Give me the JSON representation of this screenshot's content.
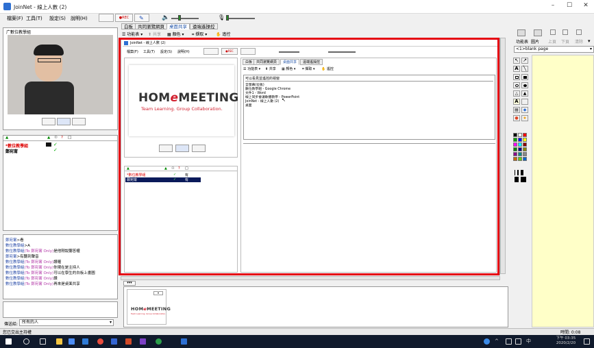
{
  "window": {
    "title": "JoinNet - 線上人數 (2)",
    "min": "–",
    "max": "☐",
    "close": "✕"
  },
  "menu": [
    "檔案(F)",
    "工具(T)",
    "設定(S)",
    "說明(H)"
  ],
  "toolbar": {
    "rec_label": "●REC"
  },
  "main_tabs": [
    "白板",
    "共同瀏覽網頁",
    "桌面共享",
    "遠端遙操控"
  ],
  "main_active_tab": 2,
  "main_toolbar": {
    "function_table": "功能表",
    "share": "共享",
    "color": "顏色",
    "capture": "擷取",
    "control": "遙控"
  },
  "video": {
    "label": "广數位教學組"
  },
  "users": {
    "headers": [
      "▲",
      "▲",
      "☉",
      "?",
      "□"
    ],
    "rows": [
      {
        "name": "*數位教學組",
        "check": "✓",
        "role": "host"
      },
      {
        "name": "鄭宛甯",
        "check": "✓",
        "role": "guest"
      }
    ]
  },
  "chat": {
    "lines": [
      {
        "who": "鄭宛甯",
        "to": "",
        "msg": ">看"
      },
      {
        "who": "數位教學組",
        "to": "",
        "msg": ">A"
      },
      {
        "who": "數位教學組",
        "to": "(To 鄭宛甯 Only)",
        "msg": "是他剛說聽答權"
      },
      {
        "who": "鄭宛甯",
        "to": "",
        "msg": ">有聽到聲音"
      },
      {
        "who": "數位教學組",
        "to": "(To 鄭宛甯 Only)",
        "msg": "讚喔"
      },
      {
        "who": "數位教學組",
        "to": "(To 鄭宛甯 Only)",
        "msg": "你現在是主持人"
      },
      {
        "who": "數位教學組",
        "to": "(To 鄭宛甯 Only)",
        "msg": "可以在學生的白板上畫圖"
      },
      {
        "who": "數位教學組",
        "to": "(To 鄭宛甯 Only)",
        "msg": "讚"
      },
      {
        "who": "數位教學組",
        "to": "(To 鄭宛甯 Only)",
        "msg": "再來是桌面共享"
      }
    ],
    "send_to_label": "傳送給:",
    "send_to_value": "所有的人"
  },
  "inner": {
    "title": "JoinNet - 線上人數 (2)",
    "menu": [
      "檔案(F)",
      "工具(T)",
      "設定(S)",
      "說明(H)"
    ],
    "logo": {
      "pre": "HOM",
      "e": "e",
      "post": "MEETING",
      "tagline": "Team Learning. Group Collaboration."
    },
    "users": [
      {
        "name": "*數位教學組",
        "check": "✓",
        "right": "有"
      },
      {
        "name": "鄭宛甯",
        "check": "✓",
        "right": "有"
      }
    ],
    "tabs": [
      "白板",
      "共同瀏覽網頁",
      "桌面共享",
      "遠端遙操控"
    ],
    "toolbar": {
      "function_table": "功能表",
      "share": "共享",
      "color": "顏色",
      "capture": "擷取",
      "control": "遙控"
    },
    "list_header": "可以看見並遙控的視窗",
    "list_items": [
      "全螢幕(位板)",
      "數位教學組 - Google Chrome",
      "文件1 - Word",
      "線上同步會議軟體教學 - PowerPoint",
      "JoinNet - 線上人數 (2)",
      "桌面"
    ]
  },
  "right_panel": {
    "buttons": [
      "功能表",
      "圖片",
      "上頁",
      "下頁",
      "清除"
    ],
    "page_select": "<1>blank page"
  },
  "thumbnail": {
    "logo_pre": "HOM",
    "logo_e": "e",
    "logo_post": "MEETING",
    "tagline": "Team Learning. Group Collaboration."
  },
  "status": {
    "left": "您已交出主持權",
    "time_label": "時間: 0:08"
  },
  "taskbar": {
    "ime": "中",
    "time": "下午 03:35",
    "date": "2020/2/20"
  },
  "colors": {
    "red_box": "#e50012",
    "accent": "#2255aa",
    "taskbar": "#101a2c",
    "whiteboard": "#ffffc8"
  }
}
